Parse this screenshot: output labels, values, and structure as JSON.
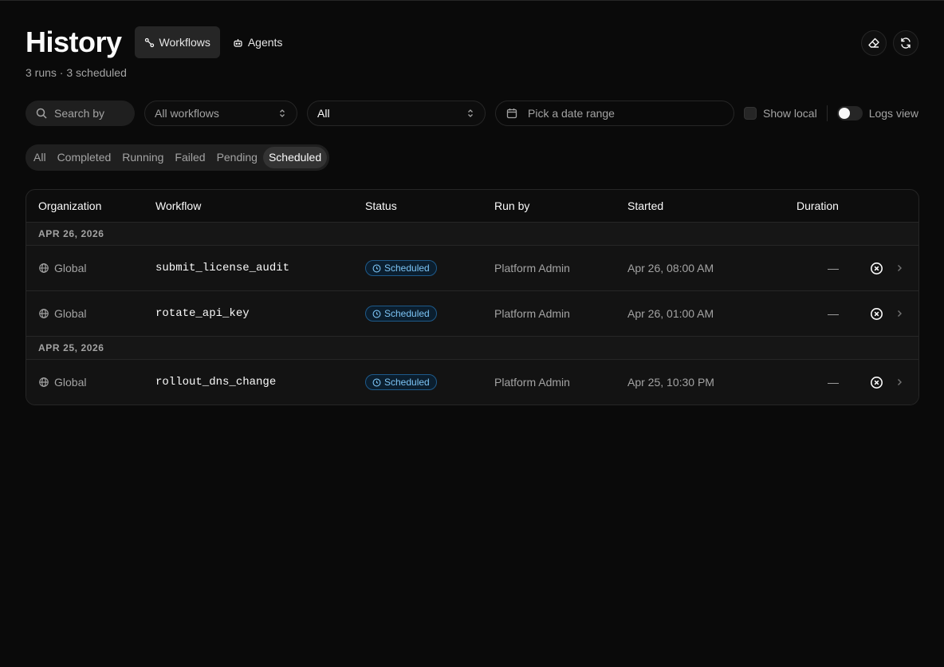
{
  "page": {
    "title": "History",
    "subtitle": "3 runs · 3 scheduled"
  },
  "mode_tabs": [
    {
      "label": "Workflows",
      "icon": "workflow-icon",
      "active": true
    },
    {
      "label": "Agents",
      "icon": "bot-icon",
      "active": false
    }
  ],
  "header_actions": [
    {
      "icon": "eraser-icon"
    },
    {
      "icon": "refresh-icon"
    }
  ],
  "filters": {
    "search_placeholder": "Search by",
    "workflows_select": "All workflows",
    "status_select": "All",
    "date_placeholder": "Pick a date range",
    "show_local_label": "Show local",
    "logs_view_label": "Logs view"
  },
  "status_tabs": [
    {
      "label": "All",
      "active": false
    },
    {
      "label": "Completed",
      "active": false
    },
    {
      "label": "Running",
      "active": false
    },
    {
      "label": "Failed",
      "active": false
    },
    {
      "label": "Pending",
      "active": false
    },
    {
      "label": "Scheduled",
      "active": true
    }
  ],
  "table": {
    "columns": [
      "Organization",
      "Workflow",
      "Status",
      "Run by",
      "Started",
      "Duration"
    ],
    "groups": [
      {
        "date": "APR 26, 2026",
        "rows": [
          {
            "org": "Global",
            "workflow": "submit_license_audit",
            "status": "Scheduled",
            "run_by": "Platform Admin",
            "started": "Apr 26, 08:00 AM",
            "duration": "—"
          },
          {
            "org": "Global",
            "workflow": "rotate_api_key",
            "status": "Scheduled",
            "run_by": "Platform Admin",
            "started": "Apr 26, 01:00 AM",
            "duration": "—"
          }
        ]
      },
      {
        "date": "APR 25, 2026",
        "rows": [
          {
            "org": "Global",
            "workflow": "rollout_dns_change",
            "status": "Scheduled",
            "run_by": "Platform Admin",
            "started": "Apr 25, 10:30 PM",
            "duration": "—"
          }
        ]
      }
    ]
  },
  "colors": {
    "background": "#0a0a0a",
    "badge_scheduled": "#7cc4f5"
  }
}
